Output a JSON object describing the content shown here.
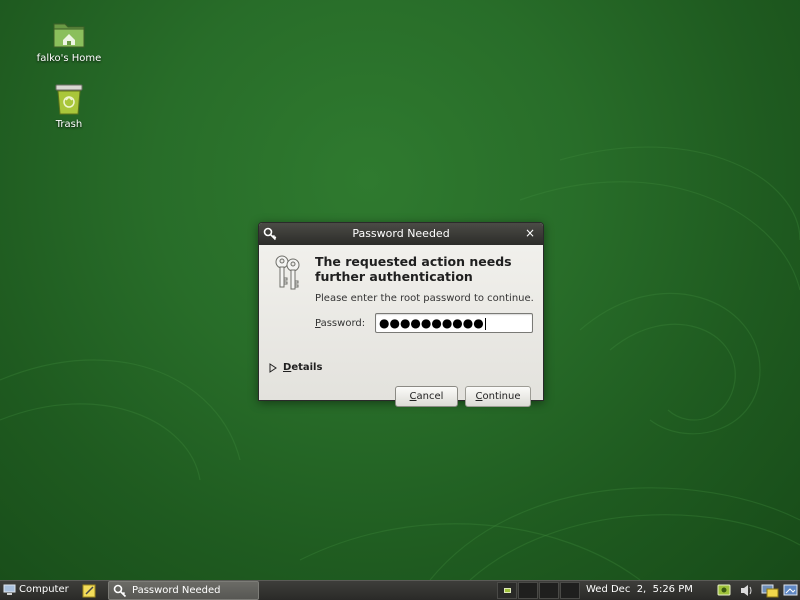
{
  "desktop": {
    "background_color": "#286d29",
    "icons": [
      {
        "label": "falko's Home",
        "icon": "home-folder-icon"
      },
      {
        "label": "Trash",
        "icon": "trash-icon"
      }
    ]
  },
  "dialog": {
    "title": "Password Needed",
    "close_glyph": "×",
    "heading": "The requested action needs further authentication",
    "instruction": "Please enter the root password to continue.",
    "password": {
      "label_mnemonic": "P",
      "label_rest": "assword:",
      "value_masked": "●●●●●●●●●●"
    },
    "details": {
      "mnemonic": "D",
      "label_rest": "etails",
      "expanded": false
    },
    "buttons": {
      "cancel_mnemonic": "C",
      "cancel_rest": "ancel",
      "continue_mnemonic": "C",
      "continue_rest": "ontinue"
    }
  },
  "taskbar": {
    "menu_label": "Computer",
    "task_label": "Password Needed",
    "workspace_count": 4,
    "active_workspace": 1,
    "clock": "Wed Dec  2,  5:26 PM",
    "accent_color": "#9fc23b"
  }
}
